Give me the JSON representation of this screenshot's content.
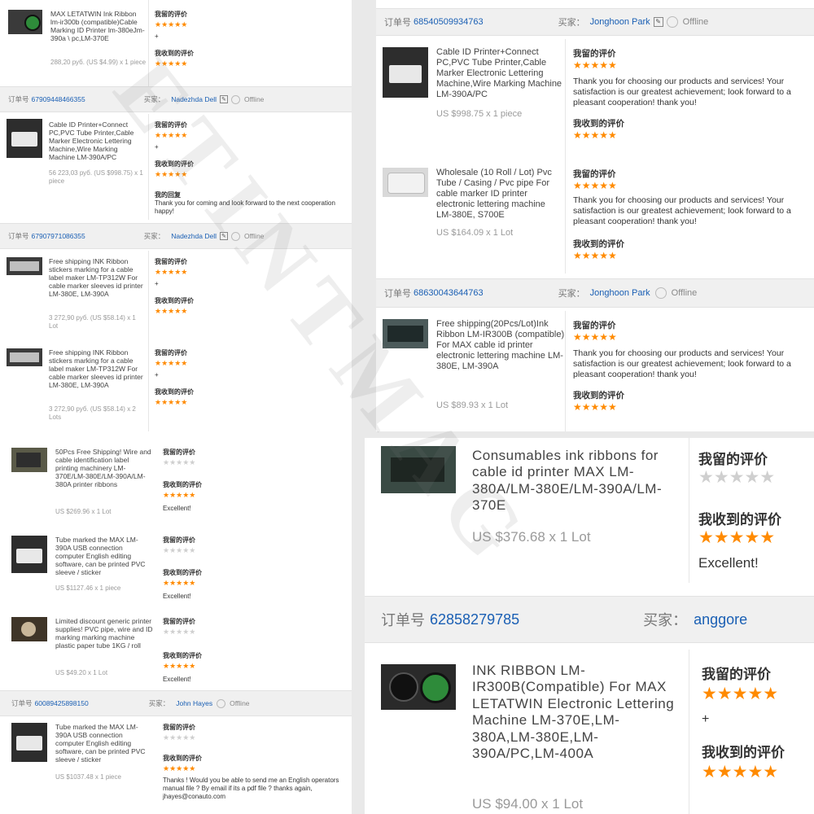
{
  "colors": {
    "accent": "#1a5fb4",
    "star": "#ff8a00",
    "star_empty": "#cfcfcf",
    "price": "#9a9a9a"
  },
  "labels": {
    "order_no": "订单号",
    "buyer": "买家：",
    "my_review": "我留的评价",
    "received_review": "我收到的评价",
    "reply": "我的回复",
    "offline": "Offline"
  },
  "stars": {
    "five": "★★★★★",
    "empty": "★★★★★"
  },
  "left": {
    "item0": {
      "title": "MAX LETATWIN Ink Ribbon lm-ir300b (compatible)Cable Marking ID Printer lm-380eJm-390a \\ pc,LM-370E",
      "price": "288,20 руб. (US $4.99) x 1 piece",
      "comment": "+"
    },
    "order1": {
      "no": "67909448466355",
      "buyer": "Nadezhda Dell"
    },
    "item1": {
      "title": "Cable ID Printer+Connect PC,PVC Tube Printer,Cable Marker Electronic Lettering Machine,Wire Marking Machine LM-390A/PC",
      "price": "56 223,03 руб. (US $998.75) x 1 piece",
      "comment": "+",
      "reply": "Thank you for coming and look forward to the next cooperation happy!"
    },
    "order2": {
      "no": "67907971086355",
      "buyer": "Nadezhda Dell"
    },
    "item2": {
      "title": "Free shipping INK Ribbon stickers marking for a cable label maker LM-TP312W For cable marker sleeves id printer LM-380E, LM-390A",
      "price": "3 272,90 руб. (US $58.14) x 1 Lot",
      "comment": "+"
    },
    "item3": {
      "title": "Free shipping INK Ribbon stickers marking for a cable label maker LM-TP312W For cable marker sleeves id printer LM-380E, LM-390A",
      "price": "3 272,90 руб. (US $58.14) x 2 Lots",
      "comment": "+"
    },
    "item4": {
      "title": "50Pcs Free Shipping! Wire and cable identification label printing machinery LM-370E/LM-380E/LM-390A/LM-380A printer ribbons",
      "price": "US $269.96 x 1 Lot",
      "comment": "Excellent!"
    },
    "item5": {
      "title": "Tube marked the MAX LM-390A USB connection computer English editing software, can be printed PVC sleeve / sticker",
      "price": "US $1127.46 x 1 piece",
      "comment": "Excellent!"
    },
    "item6": {
      "title": "Limited discount generic printer supplies! PVC pipe, wire and ID marking marking machine plastic paper tube 1KG / roll",
      "price": "US $49.20 x 1 Lot",
      "comment": "Excellent!"
    },
    "order3": {
      "no": "60089425898150",
      "buyer": "John Hayes"
    },
    "item7": {
      "title": "Tube marked the MAX LM-390A USB connection computer English editing software, can be printed PVC sleeve / sticker",
      "price": "US $1037.48 x 1 piece",
      "comment": "Thanks ! Would you be able to send me an English operators manual file ? By email if its a pdf file ? thanks again, jhayes@conauto.com"
    }
  },
  "right": {
    "order1": {
      "no": "68540509934763",
      "buyer": "Jonghoon Park"
    },
    "item1": {
      "title": "Cable ID Printer+Connect PC,PVC Tube Printer,Cable Marker Electronic Lettering Machine,Wire Marking Machine LM-390A/PC",
      "price": "US $998.75 x 1 piece",
      "comment": "Thank you for choosing our products and services! Your satisfaction is our greatest achievement; look forward to a pleasant cooperation! thank you!"
    },
    "item2": {
      "title": "Wholesale (10 Roll / Lot) Pvc Tube / Casing / Pvc pipe For cable marker ID printer electronic lettering machine LM-380E, S700E",
      "price": "US $164.09 x 1 Lot",
      "comment": "Thank you for choosing our products and services! Your satisfaction is our greatest achievement; look forward to a pleasant cooperation! thank you!"
    },
    "order2": {
      "no": "68630043644763",
      "buyer": "Jonghoon Park"
    },
    "item3": {
      "title": "Free shipping(20Pcs/Lot)Ink Ribbon LM-IR300B (compatible) For MAX cable id printer electronic lettering machine LM-380E, LM-390A",
      "price": "US $89.93 x 1 Lot",
      "comment": "Thank you for choosing our products and services! Your satisfaction is our greatest achievement; look forward to a pleasant cooperation! thank you!"
    },
    "item4": {
      "title": "Consumables ink ribbons for cable id printer MAX LM-380A/LM-380E/LM-390A/LM-370E",
      "price": "US $376.68 x 1 Lot",
      "comment": "Excellent!"
    },
    "order3": {
      "no": "62858279785",
      "buyer": "anggore"
    },
    "item5": {
      "title": "INK RIBBON LM-IR300B(Compatible) For MAX LETATWIN Electronic Lettering Machine LM-370E,LM-380A,LM-380E,LM-390A/PC,LM-400A",
      "price": "US $94.00 x 1 Lot",
      "comment": "+"
    }
  },
  "watermark": "ETINTMAG"
}
